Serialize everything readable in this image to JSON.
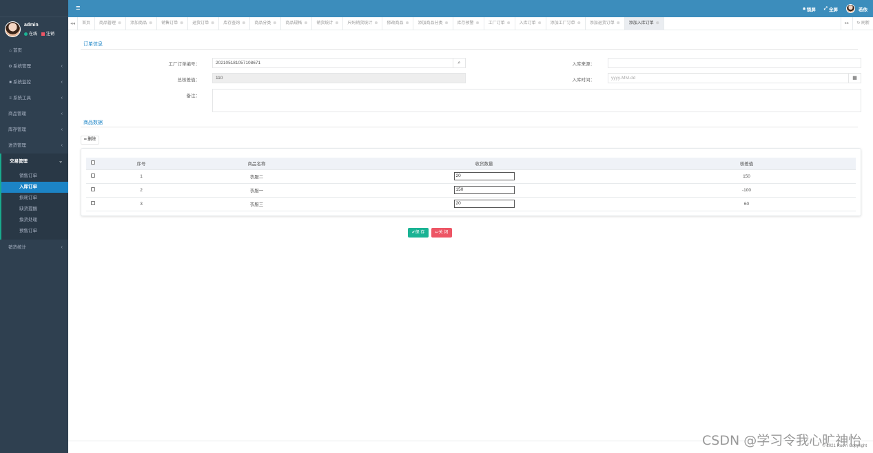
{
  "header": {
    "lock_label": "锁屏",
    "fullscreen_label": "全屏",
    "user_label": "若依"
  },
  "sidebar": {
    "username": "admin",
    "status_online": "在线",
    "logout": "注销",
    "items": [
      {
        "label": "首页",
        "icon": "home-icon"
      },
      {
        "label": "系统管理",
        "icon": "gear-icon"
      },
      {
        "label": "系统监控",
        "icon": "video-icon"
      },
      {
        "label": "系统工具",
        "icon": "bars-icon"
      },
      {
        "label": "商品管理"
      },
      {
        "label": "库存管理"
      },
      {
        "label": "进货管理"
      },
      {
        "label": "交易管理"
      },
      {
        "label": "销货统计"
      }
    ],
    "submenu": [
      "销售订单",
      "入库订单",
      "损耗订单",
      "缺货提醒",
      "換货处理",
      "预售订单"
    ]
  },
  "tabs": [
    "首页",
    "商品管理",
    "添加商品",
    "销售订单",
    "退货订单",
    "库存查询",
    "商品分类",
    "商品规格",
    "销货统计",
    "尺码销货统计",
    "修改商品",
    "添加商品分类",
    "库存预警",
    "工厂订单",
    "入库订单",
    "添加工厂订单",
    "添加退货订单",
    "添加入库订单"
  ],
  "tab_refresh": "刷新",
  "form": {
    "section_order": "订单信息",
    "factory_order_label": "工厂订单编号：",
    "factory_order_value": "202105181057108671",
    "source_label": "入库来源：",
    "source_value": "",
    "total_diff_label": "总核差值：",
    "total_diff_value": "110",
    "time_label": "入库时间：",
    "time_placeholder": "yyyy-MM-dd",
    "note_label": "备注："
  },
  "goods": {
    "section_title": "商品数据",
    "delete_label": "删除",
    "columns": [
      "序号",
      "商品名称",
      "收货数量",
      "核差值"
    ],
    "rows": [
      {
        "index": "1",
        "name": "衣服二",
        "qty": "20",
        "diff": "150"
      },
      {
        "index": "2",
        "name": "衣服一",
        "qty": "150",
        "diff": "-100"
      },
      {
        "index": "3",
        "name": "衣服三",
        "qty": "20",
        "diff": "60"
      }
    ]
  },
  "actions": {
    "save": "保 存",
    "close": "关 闭"
  },
  "watermark": "CSDN @学习令我心旷神怡",
  "copyright": "© 2021 RuoYi Copyright",
  "colors": {
    "sidebar": "#2f4050",
    "header": "#3c8dbc",
    "active": "#1c84c6",
    "save": "#1ab394",
    "close": "#ed5565"
  }
}
